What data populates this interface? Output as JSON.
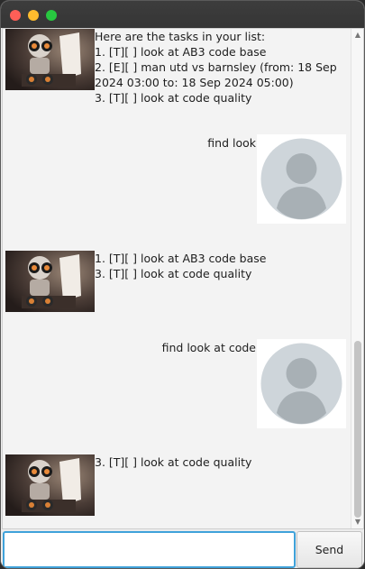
{
  "window": {
    "controls": [
      "close",
      "minimize",
      "maximize"
    ]
  },
  "dialogs": [
    {
      "role": "bot",
      "avatar": "robot-avatar",
      "lines": [
        "Here are the tasks in your list:",
        "1. [T][ ] look at AB3 code base",
        "2. [E][ ] man utd vs barnsley (from: 18 Sep 2024 03:00 to: 18 Sep 2024 05:00)",
        "3. [T][ ] look at code quality"
      ]
    },
    {
      "role": "user",
      "avatar": "user-avatar",
      "text": "find look"
    },
    {
      "role": "bot",
      "avatar": "robot-avatar",
      "lines": [
        "1. [T][ ] look at AB3 code base",
        "3. [T][ ] look at code quality"
      ]
    },
    {
      "role": "user",
      "avatar": "user-avatar",
      "text": "find look at code"
    },
    {
      "role": "bot",
      "avatar": "robot-avatar",
      "lines": [
        "3. [T][ ] look at code quality"
      ]
    }
  ],
  "input": {
    "value": "",
    "placeholder": ""
  },
  "send_button": {
    "label": "Send"
  },
  "colors": {
    "input_focus": "#3fa2da",
    "background": "#f3f3f3"
  }
}
